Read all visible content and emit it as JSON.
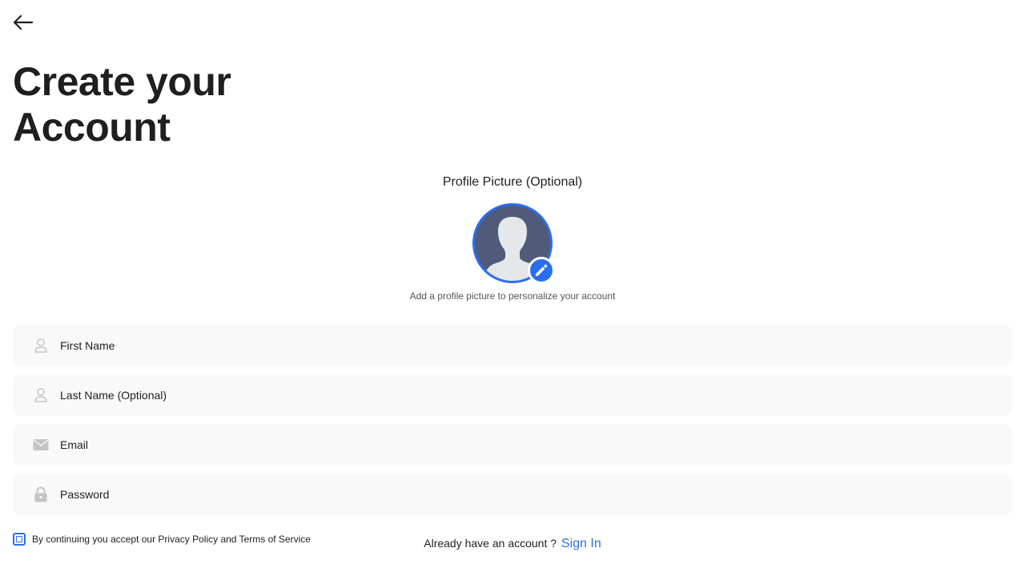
{
  "header": {
    "back_icon": "arrow-left-icon",
    "title_line1": "Create your",
    "title_line2": "Account"
  },
  "profile": {
    "label": "Profile Picture (Optional)",
    "avatar_icon": "person-silhouette-icon",
    "edit_icon": "pencil-icon",
    "hint": "Add a profile picture to personalize your account"
  },
  "form": {
    "first_name": {
      "placeholder": "First Name",
      "value": "",
      "icon": "user-icon"
    },
    "last_name": {
      "placeholder": "Last Name (Optional)",
      "value": "",
      "icon": "user-icon"
    },
    "email": {
      "placeholder": "Email",
      "value": "",
      "icon": "mail-icon"
    },
    "password": {
      "placeholder": "Password",
      "value": "",
      "icon": "lock-icon"
    }
  },
  "terms": {
    "text": "By continuing you accept our Privacy Policy and Terms of Service",
    "checked": false
  },
  "signin": {
    "prompt": "Already have an account ?",
    "link": "Sign In"
  },
  "colors": {
    "accent": "#2a6ef0",
    "field_bg": "#f9f9f9",
    "text": "#1f1f1f",
    "icon_gray": "#c4c4c4",
    "avatar_bg": "#525a7a"
  }
}
